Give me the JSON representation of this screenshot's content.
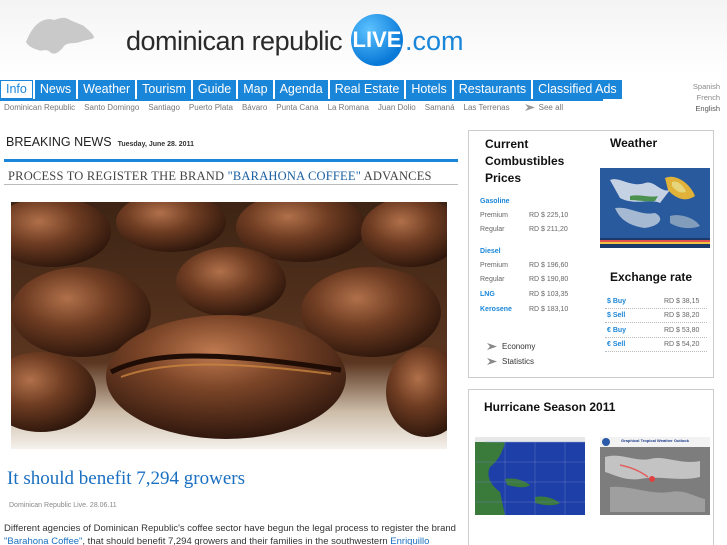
{
  "header": {
    "logo_text": "dominican republic",
    "logo_live": "LIVE",
    "logo_com": ".com"
  },
  "nav": {
    "tabs": [
      "Info",
      "News",
      "Weather",
      "Tourism",
      "Guide",
      "Map",
      "Agenda",
      "Real Estate",
      "Hotels",
      "Restaurants",
      "Classified Ads"
    ],
    "active": "Info"
  },
  "subnav": {
    "items": [
      "Dominican Republic",
      "Santo Domingo",
      "Santiago",
      "Puerto Plata",
      "Bávaro",
      "Punta Cana",
      "La Romana",
      "Juan Dolio",
      "Samaná",
      "Las Terrenas"
    ],
    "see_all": "See all"
  },
  "languages": [
    "Spanish",
    "French",
    "English"
  ],
  "breaking": {
    "label": "BREAKING NEWS",
    "date": "Tuesday, June 28. 2011"
  },
  "article": {
    "headline_pre": "PROCESS TO REGISTER THE BRAND ",
    "headline_brand": "\"BARAHONA COFFEE\"",
    "headline_post": " ADVANCES",
    "subhead": "It should benefit 7,294 growers",
    "byline": "Dominican Republic Live. 28.06.11",
    "body_pre": "Different agencies of Dominican Republic's coffee sector have begun the legal process to register the brand ",
    "body_link1": "\"Barahona Coffee\"",
    "body_mid": ", that should benefit 7,294 growers and their families in the southwestern ",
    "body_link2": "Enriquillo region..."
  },
  "fuel_panel": {
    "title_lines": [
      "Current",
      "Combustibles",
      "Prices"
    ],
    "gasoline": {
      "label": "Gasoline",
      "rows": [
        {
          "name": "Premium",
          "price": "RD $ 225,10"
        },
        {
          "name": "Regular",
          "price": "RD $ 211,20"
        }
      ]
    },
    "diesel": {
      "label": "Diesel",
      "rows": [
        {
          "name": "Premium",
          "price": "RD $ 196,60"
        },
        {
          "name": "Regular",
          "price": "RD $ 190,80"
        }
      ]
    },
    "lng": {
      "label": "LNG",
      "price": "RD $ 103,35"
    },
    "kerosene": {
      "label": "Kerosene",
      "price": "RD $ 183,10"
    },
    "links": [
      "Economy",
      "Statistics"
    ]
  },
  "weather": {
    "title": "Weather"
  },
  "exchange": {
    "title": "Exchange rate",
    "rows": [
      {
        "label": "$ Buy",
        "value": "RD $ 38,15"
      },
      {
        "label": "$ Sell",
        "value": "RD $ 38,20"
      },
      {
        "label": "€ Buy",
        "value": "RD $ 53,80"
      },
      {
        "label": "€ Sell",
        "value": "RD $ 54,20"
      }
    ]
  },
  "hurricane": {
    "title": "Hurricane Season 2011",
    "map2_caption": "Graphical Tropical Weather Outlook"
  },
  "colors": {
    "brand_blue": "#1a86d9",
    "link_blue": "#1a6fc0"
  }
}
